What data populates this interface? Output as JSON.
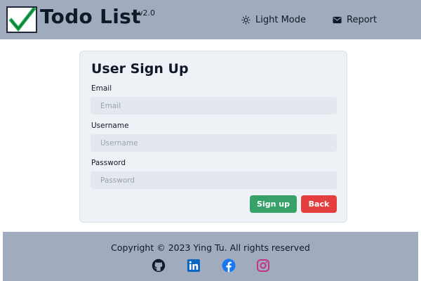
{
  "header": {
    "brand": "Todo List",
    "version": "v2.0",
    "nav": {
      "light_mode": "Light Mode",
      "report": "Report"
    }
  },
  "signup": {
    "title": "User Sign Up",
    "email": {
      "label": "Email",
      "placeholder": "Email",
      "value": ""
    },
    "username": {
      "label": "Username",
      "placeholder": "Username",
      "value": ""
    },
    "password": {
      "label": "Password",
      "placeholder": "Password",
      "value": ""
    },
    "signup_button": "Sign up",
    "back_button": "Back"
  },
  "footer": {
    "copyright": "Copyright © 2023 Ying Tu. All rights reserved",
    "social_icons": [
      "github-icon",
      "linkedin-icon",
      "facebook-icon",
      "instagram-icon"
    ]
  },
  "colors": {
    "header_bg": "#a0acbd",
    "card_bg": "#eef2f6",
    "signup_green": "#38a169",
    "back_red": "#e53e3e",
    "checkmark_green": "#16a34a",
    "linkedin_blue": "#0a66c2",
    "facebook_blue": "#1877f2",
    "instagram_pink": "#c13584"
  }
}
